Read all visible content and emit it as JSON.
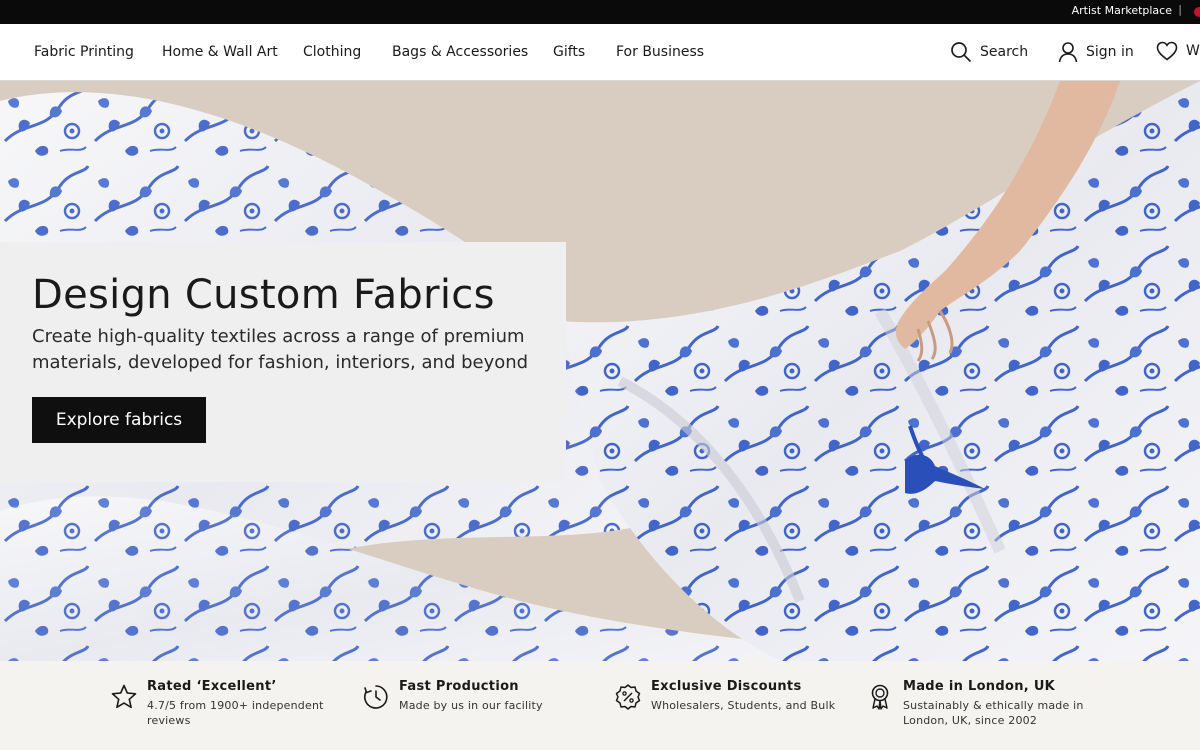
{
  "topbar": {
    "artist_marketplace": "Artist Marketplace",
    "separator": "|"
  },
  "nav": {
    "items": [
      {
        "label": "Fabric Printing"
      },
      {
        "label": "Home & Wall Art"
      },
      {
        "label": "Clothing"
      },
      {
        "label": "Bags & Accessories"
      },
      {
        "label": "Gifts"
      },
      {
        "label": "For Business"
      }
    ],
    "search_label": "Search",
    "signin_label": "Sign in",
    "wishlist_label": "W",
    "icons": [
      "search-icon",
      "user-icon",
      "heart-icon"
    ]
  },
  "hero": {
    "title": "Design Custom Fabrics",
    "subtitle": "Create high-quality textiles across a range of premium materials, developed for fashion, interiors, and beyond",
    "cta_label": "Explore fabrics",
    "colors": {
      "pattern_blue": "#2f56c4",
      "fabric_white": "#f4f4f6",
      "wall": "#d8ccc0"
    }
  },
  "features": [
    {
      "icon": "star-icon",
      "title": "Rated ‘Excellent’",
      "desc": "4.7/5 from 1900+ independent reviews"
    },
    {
      "icon": "clock-icon",
      "title": "Fast Production",
      "desc": "Made by us in our facility"
    },
    {
      "icon": "discount-badge-icon",
      "title": "Exclusive Discounts",
      "desc": "Wholesalers, Students, and Bulk"
    },
    {
      "icon": "award-ribbon-icon",
      "title": "Made in London, UK",
      "desc": "Sustainably & ethically made in London, UK, since 2002"
    }
  ]
}
